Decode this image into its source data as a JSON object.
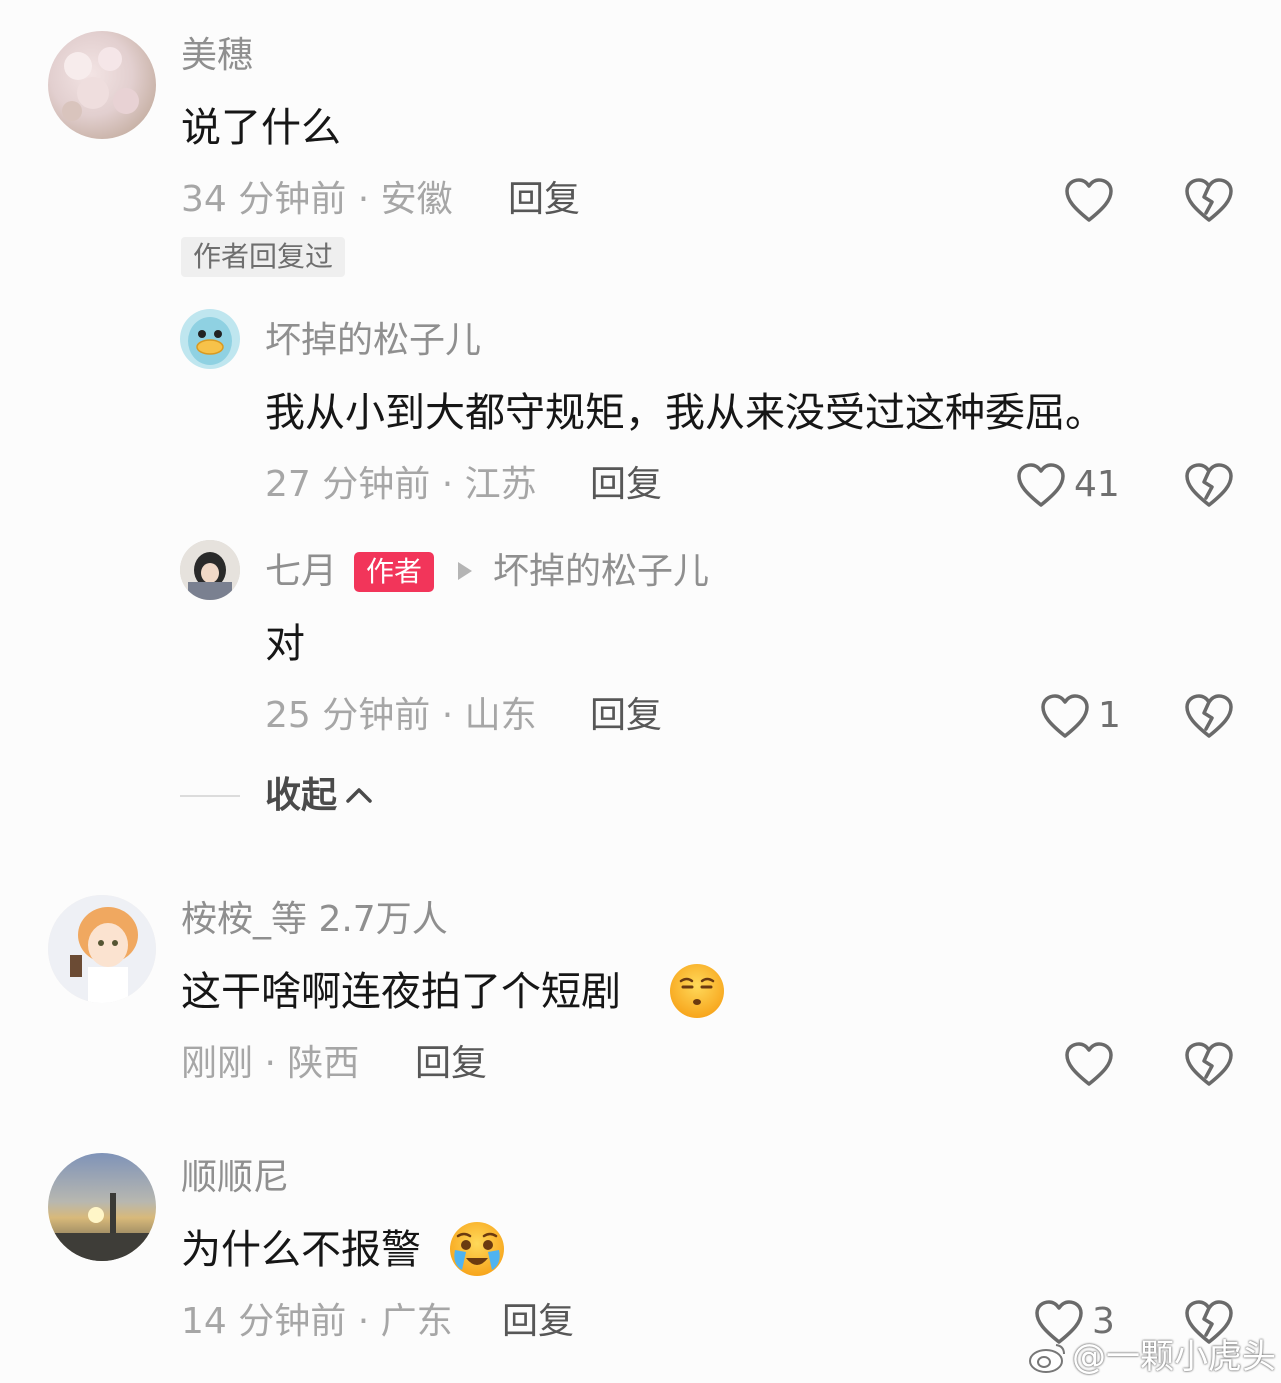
{
  "comments": [
    {
      "name": "美穗",
      "text": "说了什么",
      "meta": "34 分钟前 · 安徽",
      "reply_label": "回复",
      "tag": "作者回复过",
      "like_count": "",
      "replies": [
        {
          "name": "坏掉的松子儿",
          "text": "我从小到大都守规矩，我从来没受过这种委屈。",
          "meta": "27 分钟前 · 江苏",
          "reply_label": "回复",
          "like_count": "41"
        },
        {
          "name": "七月",
          "badge": "作者",
          "reply_to": "坏掉的松子儿",
          "text": "对",
          "meta": "25 分钟前 · 山东",
          "reply_label": "回复",
          "like_count": "1"
        }
      ],
      "collapse_label": "收起"
    },
    {
      "name": "桉桉_等 2.7万人",
      "text": "这干啥啊连夜拍了个短剧",
      "emoji": "smirk-face-icon",
      "meta": "刚刚 · 陕西",
      "reply_label": "回复",
      "like_count": ""
    },
    {
      "name": "顺顺尼",
      "text": "为什么不报警",
      "emoji": "crying-face-icon",
      "meta": "14 分钟前 · 广东",
      "reply_label": "回复",
      "like_count": "3"
    }
  ],
  "watermark": "@一颗小虎头",
  "colors": {
    "badge": "#f2355a",
    "meta": "#a6a6a6",
    "name": "#8f8f8f"
  }
}
